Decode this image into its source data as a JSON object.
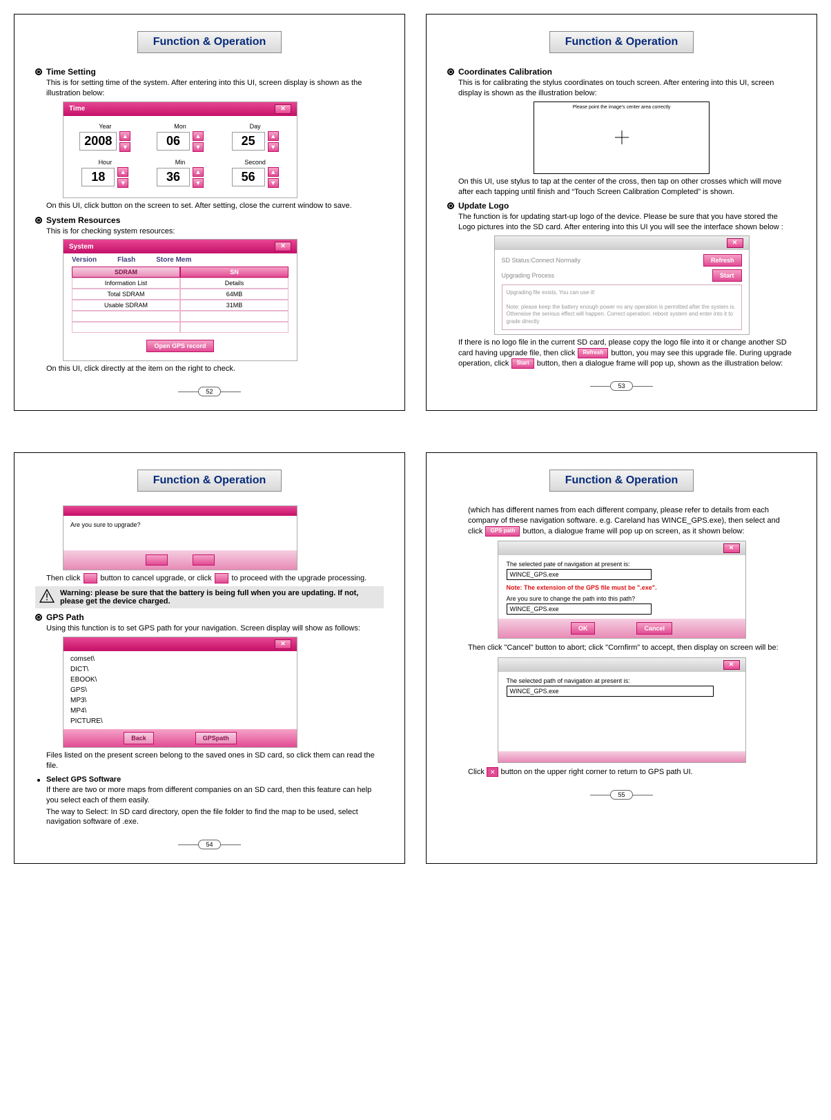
{
  "common": {
    "page_title": "Function & Operation"
  },
  "p52": {
    "time_setting_h": "Time Setting",
    "time_setting_t": "This is for setting time of the system. After entering into this UI, screen display is shown as the illustration below:",
    "time_title": "Time",
    "year_l": "Year",
    "mon_l": "Mon",
    "day_l": "Day",
    "hour_l": "Hour",
    "min_l": "Min",
    "sec_l": "Second",
    "year": "2008",
    "mon": "06",
    "day": "25",
    "hour": "18",
    "min": "36",
    "sec": "56",
    "after_time": "On this UI, click button on the screen to set. After setting, close the current window to save.",
    "sysres_h": "System Resources",
    "sysres_t": "This is for checking system resources:",
    "sys_title": "System",
    "tab1": "Version",
    "tab2": "Flash",
    "tab3": "Store Mem",
    "head1": "SDRAM",
    "head2": "SN",
    "row1a": "Information List",
    "row1b": "Details",
    "row2a": "Total SDRAM",
    "row2b": "64MB",
    "row3a": "Usable SDRAM",
    "row3b": "31MB",
    "open_gps": "Open GPS record",
    "after_sys": "On this UI, click directly at the item on the right to check.",
    "num": "52"
  },
  "p53": {
    "coord_h": "Coordinates Calibration",
    "coord_t": "This is for calibrating the stylus coordinates on touch screen. After entering into this UI, screen display is shown as the illustration below:",
    "calib_msg": "Please point the image's center area correctly",
    "coord_after": "On this UI, use stylus to tap at the center of the cross, then tap on other crosses which will move after each tapping until finish and “Touch Screen Calibration Completed” is shown.",
    "upd_h": "Update Logo",
    "upd_t": "The function is for updating start-up logo of the device. Please be sure that you have stored the Logo pictures into the SD card. After entering into this UI you will see the interface shown below :",
    "sd_status": "SD Status:Connect Normally",
    "upg_proc": "Upgrading Process",
    "refresh": "Refresh",
    "start": "Start",
    "note_line1": "Upgrading file exists, You can use it!",
    "note_line2": "Note: please keep the battery enough power no any operation is permitted after the system is. Otherwise the serious effect will happen. Correct operation: reboot system and enter into it to grade directly",
    "para2_part1": "If there is no logo file in the current SD card, please copy the logo file into it or change another SD card having upgrade file, then click",
    "para2_refresh": "Refresh",
    "para2_part2": "button, you may see this upgrade file. During upgrade operation, click",
    "para2_start": "Start",
    "para2_part3": " button, then a dialogue frame will pop up, shown as the illustration below:",
    "num": "53"
  },
  "p54": {
    "dlg_q": "Are you sure to upgrade?",
    "then_part1": "Then click ",
    "then_part2": " button to cancel upgrade, or click ",
    "then_part3": " to proceed with the upgrade processing.",
    "warn": "Warning: please be sure that the battery is being full when you are updating. If not, please get the device charged.",
    "gps_h": "GPS Path",
    "gps_t": "Using this function is to set GPS path for your navigation. Screen display will show as follows:",
    "folders": [
      "comset\\",
      "DICT\\",
      "EBOOK\\",
      "GPS\\",
      "MP3\\",
      "MP4\\",
      "PICTURE\\"
    ],
    "back": "Back",
    "gpspath": "GPSpath",
    "after_browser": "Files listed on the present screen belong to the saved ones in SD card, so click them can read the file.",
    "sel_h": "Select GPS Software",
    "sel_t1": "If there are two or more maps from different companies on an SD card, then this feature can help you select each of them easily.",
    "sel_t2": "The way to Select:  In SD card directory, open the file folder to find the map to be used, select navigation software of .exe.",
    "num": "54"
  },
  "p55": {
    "intro_part1": "(which has different names from each different company, please refer to details from each company of these navigation software. e.g. Careland has WINCE_GPS.exe), then select and click",
    "gps_path_btn": "GPS path",
    "intro_part2": "button, a dialogue frame will pop up on screen, as it shown below:",
    "lbl1": "The selected pate of navigation at present is:",
    "val1": "WINCE_GPS.exe",
    "ext_note": "Note: The extension of the GPS file must be \".exe\".",
    "lbl2": "Are you sure to change the path into this path?",
    "val2": "WINCE_GPS.exe",
    "ok": "OK",
    "cancel": "Cancel",
    "mid": "Then click \"Cancel\" button to abort; click \"Cornfirm\" to accept, then display on screen will be:",
    "lbl3": "The selected path of navigation at present is:",
    "val3": "WINCE_GPS.exe",
    "close_part1": "Click",
    "close_part2": " button on the upper right corner to return to GPS path UI.",
    "num": "55"
  }
}
